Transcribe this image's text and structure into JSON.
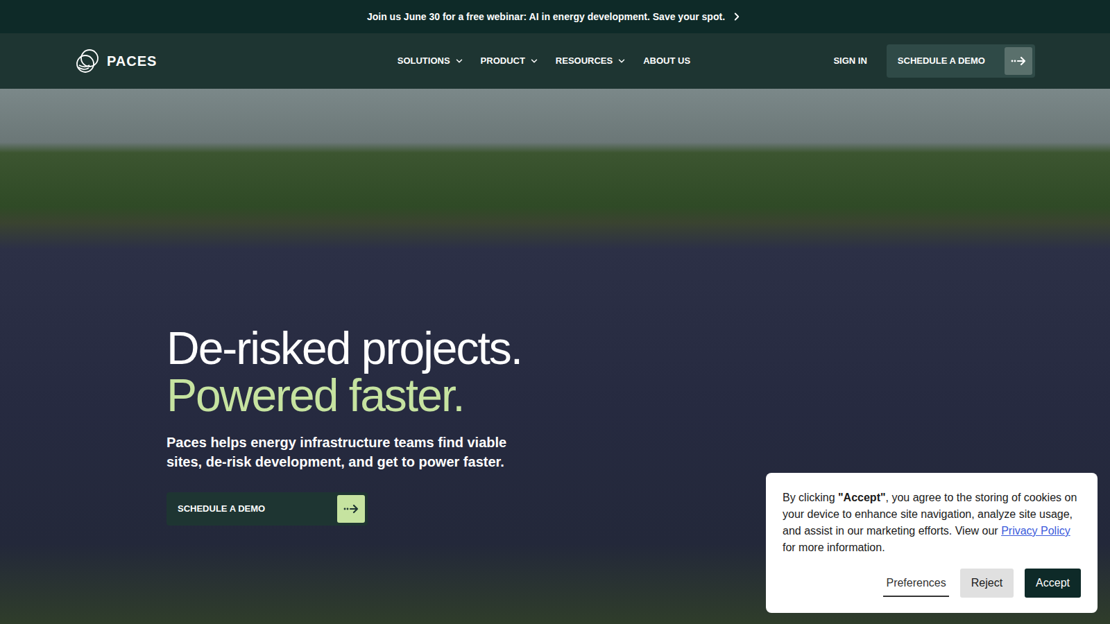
{
  "banner": {
    "text": "Join us June 30 for a free webinar: AI in energy development. Save your spot."
  },
  "nav": {
    "logo": "PACES",
    "items": [
      {
        "label": "SOLUTIONS",
        "dropdown": true
      },
      {
        "label": "PRODUCT",
        "dropdown": true
      },
      {
        "label": "RESOURCES",
        "dropdown": true
      },
      {
        "label": "ABOUT US",
        "dropdown": false
      }
    ],
    "sign_in": "SIGN IN",
    "cta": "SCHEDULE A DEMO"
  },
  "hero": {
    "heading_line1": "De-risked projects.",
    "heading_line2": "Powered faster.",
    "subtitle_lines": [
      "Paces helps energy infrastructure teams find viable",
      "sites, de-risk development, and get to power faster."
    ],
    "cta": "SCHEDULE A DEMO"
  },
  "cookie_banner": {
    "text_before": "By clicking ",
    "bold": "\"Accept\"",
    "text_middle": ", you agree to the storing of cookies on your device to enhance site navigation, analyze site usage, and assist in our marketing efforts. View our ",
    "link": "Privacy Policy",
    "text_after": " for more information.",
    "buttons": [
      {
        "label": "Preferences",
        "kind": "link"
      },
      {
        "label": "Reject",
        "kind": "secondary"
      },
      {
        "label": "Accept",
        "kind": "primary"
      }
    ]
  }
}
